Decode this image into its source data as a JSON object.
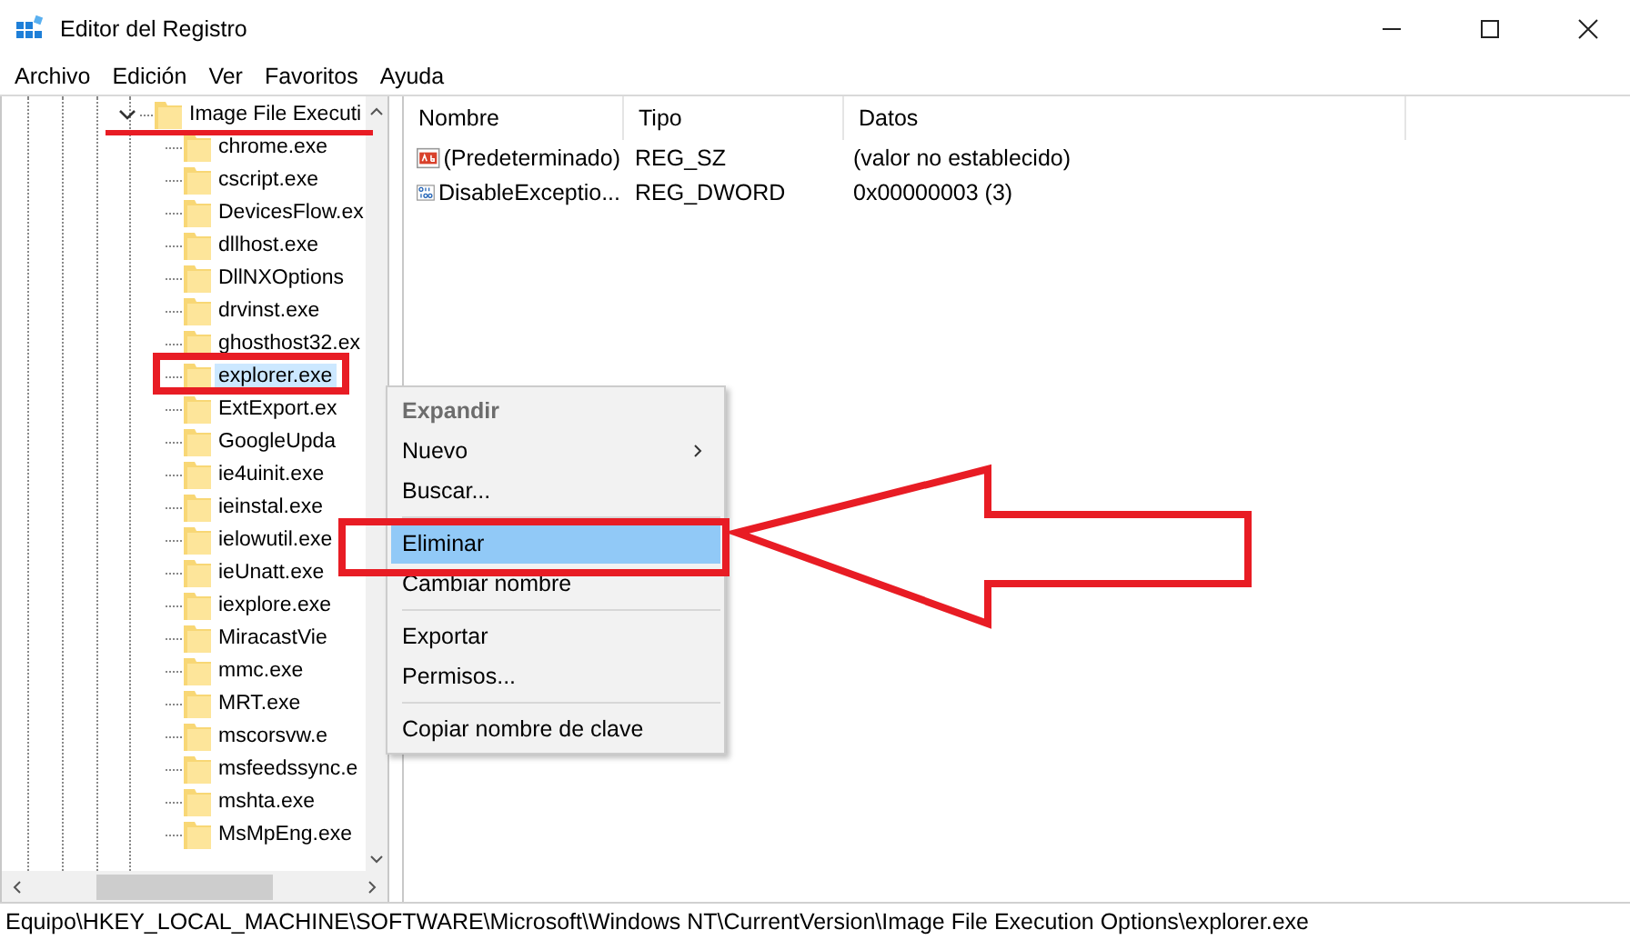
{
  "window": {
    "title": "Editor del Registro"
  },
  "menu_bar": [
    "Archivo",
    "Edición",
    "Ver",
    "Favoritos",
    "Ayuda"
  ],
  "tree": {
    "label": "Image File Executi",
    "expanded": true,
    "children": [
      {
        "label": "chrome.exe",
        "selected": false
      },
      {
        "label": "cscript.exe",
        "selected": false
      },
      {
        "label": "DevicesFlow.ex",
        "selected": false
      },
      {
        "label": "dllhost.exe",
        "selected": false
      },
      {
        "label": "DllNXOptions",
        "selected": false
      },
      {
        "label": "drvinst.exe",
        "selected": false
      },
      {
        "label": "ghosthost32.ex",
        "selected": false
      },
      {
        "label": "explorer.exe",
        "selected": true
      },
      {
        "label": "ExtExport.ex",
        "selected": false
      },
      {
        "label": "GoogleUpda",
        "selected": false
      },
      {
        "label": "ie4uinit.exe",
        "selected": false
      },
      {
        "label": "ieinstal.exe",
        "selected": false
      },
      {
        "label": "ielowutil.exe",
        "selected": false
      },
      {
        "label": "ieUnatt.exe",
        "selected": false
      },
      {
        "label": "iexplore.exe",
        "selected": false
      },
      {
        "label": "MiracastVie",
        "selected": false
      },
      {
        "label": "mmc.exe",
        "selected": false
      },
      {
        "label": "MRT.exe",
        "selected": false
      },
      {
        "label": "mscorsvw.e",
        "selected": false
      },
      {
        "label": "msfeedssync.e",
        "selected": false
      },
      {
        "label": "mshta.exe",
        "selected": false
      },
      {
        "label": "MsMpEng.exe",
        "selected": false
      }
    ]
  },
  "values_table": {
    "columns": [
      "Nombre",
      "Tipo",
      "Datos"
    ],
    "rows": [
      {
        "kind": "string",
        "name": "(Predeterminado)",
        "type": "REG_SZ",
        "data": "(valor no establecido)"
      },
      {
        "kind": "binary",
        "name": "DisableExceptio...",
        "type": "REG_DWORD",
        "data": "0x00000003 (3)"
      }
    ]
  },
  "context_menu": {
    "items": [
      {
        "kind": "item",
        "label": "Expandir",
        "disabled": true,
        "default": true,
        "submenu": false,
        "selected": false
      },
      {
        "kind": "item",
        "label": "Nuevo",
        "disabled": false,
        "default": false,
        "submenu": true,
        "selected": false
      },
      {
        "kind": "item",
        "label": "Buscar...",
        "disabled": false,
        "default": false,
        "submenu": false,
        "selected": false
      },
      {
        "kind": "separator"
      },
      {
        "kind": "item",
        "label": "Eliminar",
        "disabled": false,
        "default": false,
        "submenu": false,
        "selected": true
      },
      {
        "kind": "item",
        "label": "Cambiar nombre",
        "disabled": false,
        "default": false,
        "submenu": false,
        "selected": false
      },
      {
        "kind": "separator"
      },
      {
        "kind": "item",
        "label": "Exportar",
        "disabled": false,
        "default": false,
        "submenu": false,
        "selected": false
      },
      {
        "kind": "item",
        "label": "Permisos...",
        "disabled": false,
        "default": false,
        "submenu": false,
        "selected": false
      },
      {
        "kind": "separator"
      },
      {
        "kind": "item",
        "label": "Copiar nombre de clave",
        "disabled": false,
        "default": false,
        "submenu": false,
        "selected": false
      }
    ]
  },
  "status_bar": "Equipo\\HKEY_LOCAL_MACHINE\\SOFTWARE\\Microsoft\\Windows NT\\CurrentVersion\\Image File Execution Options\\explorer.exe"
}
